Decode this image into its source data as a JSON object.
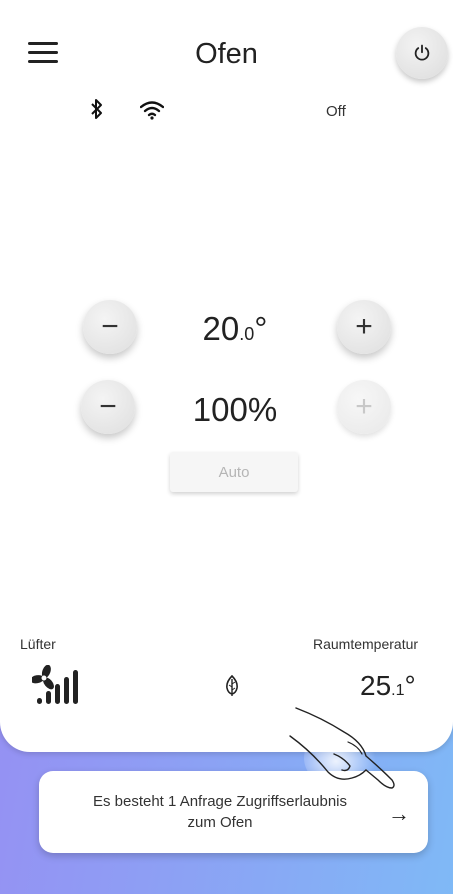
{
  "header": {
    "title": "Ofen",
    "status": "Off"
  },
  "icons": {
    "menu": "hamburger-menu-icon",
    "power": "power-icon",
    "bluetooth": "bluetooth-icon",
    "wifi": "wifi-icon",
    "fan": "fan-icon",
    "leaf": "leaf-icon",
    "arrow": "arrow-right-icon",
    "hand": "hand-pointer-icon"
  },
  "controls": {
    "temperature": {
      "main": "20",
      "decimal": ".0",
      "unit": "°",
      "minus": "−",
      "plus": "+"
    },
    "fan_power": {
      "value": "100%",
      "minus": "−",
      "plus": "+",
      "plus_disabled": true
    },
    "auto_label": "Auto"
  },
  "footer": {
    "fan_label": "Lüfter",
    "fan_level_bars_active": 4,
    "room_temp_label": "Raumtemperatur",
    "room_temp": {
      "main": "25",
      "decimal": ".1",
      "unit": "°"
    }
  },
  "notice": {
    "text_line1": "Es besteht 1 Anfrage Zugriffserlaubnis",
    "text_line2": "zum Ofen",
    "arrow": "→"
  },
  "colors": {
    "gradient_start": "#9a88f2",
    "gradient_end": "#7fb9f6",
    "card": "#ffffff"
  }
}
